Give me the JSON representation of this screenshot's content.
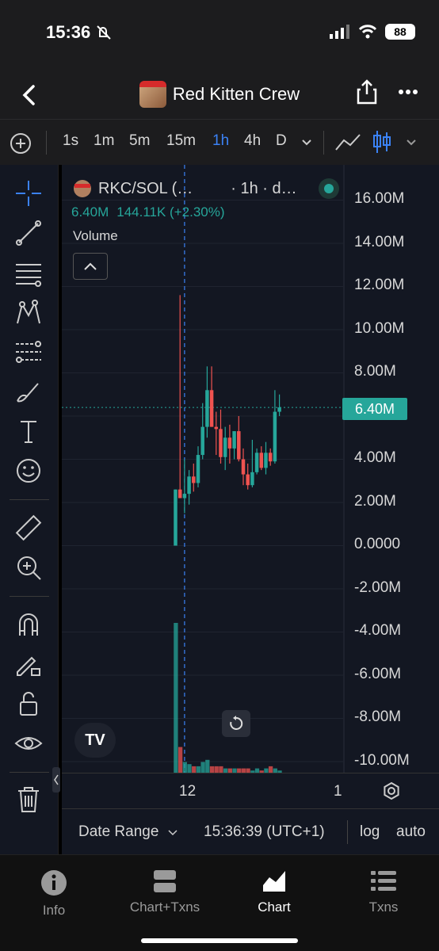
{
  "status": {
    "time": "15:36",
    "battery": "88"
  },
  "header": {
    "title": "Red Kitten Crew"
  },
  "toolbar": {
    "timeframes": [
      "1s",
      "1m",
      "5m",
      "15m",
      "1h",
      "4h",
      "D"
    ],
    "active_timeframe": "1h"
  },
  "legend": {
    "symbol": "RKC/SOL (…",
    "interval": "· 1h · d…",
    "price": "6.40M",
    "change": "144.11K (+2.30%)",
    "volume_label": "Volume"
  },
  "price_axis": {
    "labels": [
      "16.00M",
      "14.00M",
      "12.00M",
      "10.00M",
      "8.00M",
      "6.00M",
      "4.00M",
      "2.00M",
      "0.0000",
      "-2.00M",
      "-4.00M",
      "-6.00M",
      "-8.00M",
      "-10.00M"
    ],
    "last_price": "6.40M"
  },
  "time_axis": {
    "labels": [
      "12",
      "1"
    ]
  },
  "bottom_bar": {
    "date_range": "Date Range",
    "clock": "15:36:39 (UTC+1)",
    "log": "log",
    "auto": "auto"
  },
  "tabs": [
    {
      "label": "Info"
    },
    {
      "label": "Chart+Txns"
    },
    {
      "label": "Chart"
    },
    {
      "label": "Txns"
    }
  ],
  "colors": {
    "up": "#26a69a",
    "down": "#ef5350",
    "accent": "#3b82f6",
    "background": "#131722"
  },
  "chart_data": {
    "type": "candlestick",
    "series": [
      {
        "name": "RKC/SOL",
        "ohlc": [
          [
            0.0,
            2.6,
            0.0,
            2.6
          ],
          [
            2.6,
            11.6,
            2.4,
            2.2
          ],
          [
            2.2,
            4.0,
            1.5,
            2.4
          ],
          [
            2.4,
            3.5,
            1.9,
            3.2
          ],
          [
            3.2,
            3.8,
            2.5,
            2.9
          ],
          [
            2.9,
            4.6,
            2.7,
            4.2
          ],
          [
            4.2,
            6.6,
            4.0,
            5.5
          ],
          [
            5.5,
            8.3,
            5.0,
            7.2
          ],
          [
            7.2,
            8.3,
            5.5,
            5.5
          ],
          [
            5.5,
            6.2,
            4.2,
            5.4
          ],
          [
            5.4,
            6.3,
            3.8,
            4.1
          ],
          [
            4.1,
            5.5,
            3.5,
            5.0
          ],
          [
            5.0,
            5.6,
            3.8,
            4.5
          ],
          [
            4.5,
            5.3,
            4.0,
            5.3
          ],
          [
            5.3,
            6.0,
            3.9,
            4.0
          ],
          [
            4.0,
            4.5,
            2.8,
            3.3
          ],
          [
            3.3,
            3.8,
            2.6,
            2.8
          ],
          [
            2.8,
            4.9,
            2.7,
            3.4
          ],
          [
            3.4,
            4.5,
            3.3,
            4.3
          ],
          [
            4.3,
            4.6,
            3.5,
            3.6
          ],
          [
            3.6,
            4.8,
            3.3,
            4.3
          ],
          [
            4.3,
            4.5,
            3.7,
            3.9
          ],
          [
            3.9,
            7.2,
            3.8,
            6.2
          ],
          [
            6.2,
            7.0,
            6.0,
            6.4
          ]
        ]
      },
      {
        "name": "Volume",
        "values": [
          70,
          12,
          5,
          4,
          3,
          3,
          5,
          6,
          3,
          3,
          3,
          2,
          2,
          2,
          2,
          2,
          2,
          1,
          2,
          1,
          2,
          3,
          2,
          1
        ]
      }
    ],
    "ylim": [
      -10000000,
      16000000
    ]
  }
}
